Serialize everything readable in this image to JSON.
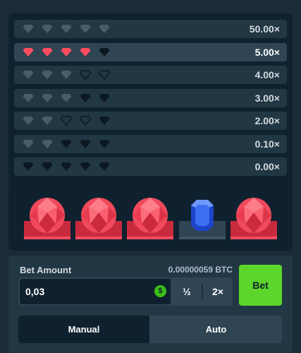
{
  "colors": {
    "background": "#1a2c38",
    "panel": "#0f212e",
    "row": "#213743",
    "row_active": "#2f4553",
    "gem_red": "#ff4c5f",
    "gem_grey": "#4a5c67",
    "gem_black": "#0b1822",
    "sapphire": "#3b6ff0",
    "bet_green": "#5cd62a"
  },
  "paytable": [
    {
      "multiplier": "50.00×",
      "gems": [
        "grey",
        "grey",
        "grey",
        "grey",
        "grey"
      ],
      "active": false
    },
    {
      "multiplier": "5.00×",
      "gems": [
        "red",
        "red",
        "red",
        "red",
        "black"
      ],
      "active": true
    },
    {
      "multiplier": "4.00×",
      "gems": [
        "grey",
        "grey",
        "grey",
        "outline",
        "outline"
      ],
      "active": false
    },
    {
      "multiplier": "3.00×",
      "gems": [
        "grey",
        "grey",
        "grey",
        "black",
        "black"
      ],
      "active": false
    },
    {
      "multiplier": "2.00×",
      "gems": [
        "grey",
        "grey",
        "outline",
        "outline",
        "black"
      ],
      "active": false
    },
    {
      "multiplier": "0.10×",
      "gems": [
        "grey",
        "grey",
        "black",
        "black",
        "black"
      ],
      "active": false
    },
    {
      "multiplier": "0.00×",
      "gems": [
        "black",
        "black",
        "black",
        "black",
        "black"
      ],
      "active": false
    }
  ],
  "result_gems": [
    {
      "icon": "ruby-icon",
      "matched": true
    },
    {
      "icon": "ruby-icon",
      "matched": true
    },
    {
      "icon": "ruby-icon",
      "matched": true
    },
    {
      "icon": "sapphire-icon",
      "matched": false
    },
    {
      "icon": "ruby-icon",
      "matched": true
    }
  ],
  "bet": {
    "label": "Bet Amount",
    "btc_amount": "0.00000059 BTC",
    "value": "0,03",
    "coin_symbol": "$",
    "half_label": "½",
    "double_label": "2×",
    "button_label": "Bet"
  },
  "mode": {
    "manual_label": "Manual",
    "auto_label": "Auto",
    "selected": "manual"
  }
}
